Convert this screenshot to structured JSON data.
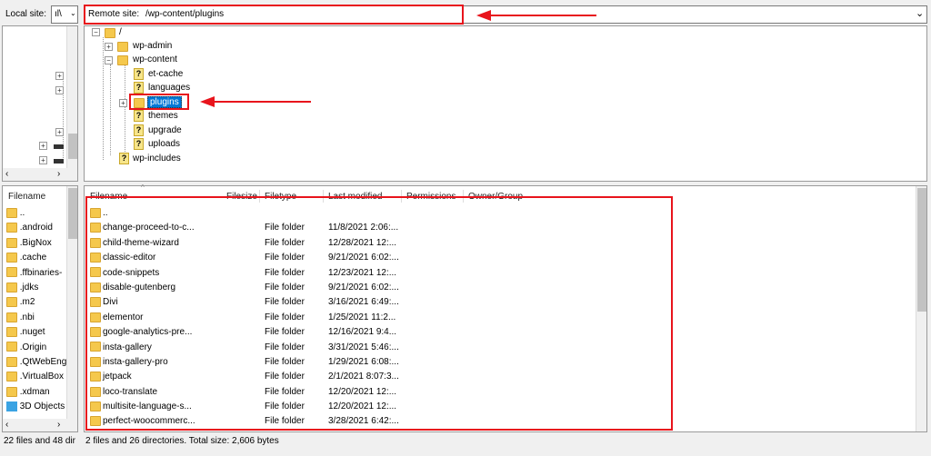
{
  "local_site": {
    "label": "Local site:",
    "value": "ıl\\"
  },
  "remote_site": {
    "label": "Remote site:",
    "value": "/wp-content/plugins"
  },
  "remote_tree": {
    "root": "/",
    "items": [
      {
        "label": "wp-admin",
        "icon": "folder-icon"
      },
      {
        "label": "wp-content",
        "icon": "folder-icon"
      },
      {
        "label": "et-cache",
        "icon": "question-icon"
      },
      {
        "label": "languages",
        "icon": "question-icon"
      },
      {
        "label": "plugins",
        "icon": "folder-icon",
        "selected": true
      },
      {
        "label": "themes",
        "icon": "question-icon"
      },
      {
        "label": "upgrade",
        "icon": "question-icon"
      },
      {
        "label": "uploads",
        "icon": "question-icon"
      },
      {
        "label": "wp-includes",
        "icon": "question-icon"
      }
    ]
  },
  "local_list": {
    "header": "Filename",
    "items": [
      {
        "label": "..",
        "icon": "folder-icon"
      },
      {
        "label": ".android",
        "icon": "folder-icon"
      },
      {
        "label": ".BigNox",
        "icon": "folder-icon"
      },
      {
        "label": ".cache",
        "icon": "folder-icon"
      },
      {
        "label": ".ffbinaries-",
        "icon": "folder-icon"
      },
      {
        "label": ".jdks",
        "icon": "folder-icon"
      },
      {
        "label": ".m2",
        "icon": "folder-icon"
      },
      {
        "label": ".nbi",
        "icon": "folder-icon"
      },
      {
        "label": ".nuget",
        "icon": "folder-icon"
      },
      {
        "label": ".Origin",
        "icon": "folder-icon"
      },
      {
        "label": ".QtWebEng",
        "icon": "folder-icon"
      },
      {
        "label": ".VirtualBox",
        "icon": "folder-icon"
      },
      {
        "label": ".xdman",
        "icon": "folder-icon"
      },
      {
        "label": "3D Objects",
        "icon": "3d-objects-icon"
      }
    ]
  },
  "remote_list": {
    "columns": [
      "Filename",
      "Filesize",
      "Filetype",
      "Last modified",
      "Permissions",
      "Owner/Group"
    ],
    "rows": [
      {
        "name": "..",
        "type": "",
        "modified": ""
      },
      {
        "name": "change-proceed-to-c...",
        "type": "File folder",
        "modified": "11/8/2021 2:06:..."
      },
      {
        "name": "child-theme-wizard",
        "type": "File folder",
        "modified": "12/28/2021 12:..."
      },
      {
        "name": "classic-editor",
        "type": "File folder",
        "modified": "9/21/2021 6:02:..."
      },
      {
        "name": "code-snippets",
        "type": "File folder",
        "modified": "12/23/2021 12:..."
      },
      {
        "name": "disable-gutenberg",
        "type": "File folder",
        "modified": "9/21/2021 6:02:..."
      },
      {
        "name": "Divi",
        "type": "File folder",
        "modified": "3/16/2021 6:49:..."
      },
      {
        "name": "elementor",
        "type": "File folder",
        "modified": "1/25/2021 11:2..."
      },
      {
        "name": "google-analytics-pre...",
        "type": "File folder",
        "modified": "12/16/2021 9:4..."
      },
      {
        "name": "insta-gallery",
        "type": "File folder",
        "modified": "3/31/2021 5:46:..."
      },
      {
        "name": "insta-gallery-pro",
        "type": "File folder",
        "modified": "1/29/2021 6:08:..."
      },
      {
        "name": "jetpack",
        "type": "File folder",
        "modified": "2/1/2021 8:07:3..."
      },
      {
        "name": "loco-translate",
        "type": "File folder",
        "modified": "12/20/2021 12:..."
      },
      {
        "name": "multisite-language-s...",
        "type": "File folder",
        "modified": "12/20/2021 12:..."
      },
      {
        "name": "perfect-woocommerc...",
        "type": "File folder",
        "modified": "3/28/2021 6:42:..."
      }
    ]
  },
  "status": {
    "local": "22 files and 48 dir",
    "remote": "2 files and 26 directories. Total size: 2,606 bytes"
  },
  "colors": {
    "highlight": "#e8141c",
    "selection": "#0078d7",
    "folder": "#f5c84c"
  }
}
